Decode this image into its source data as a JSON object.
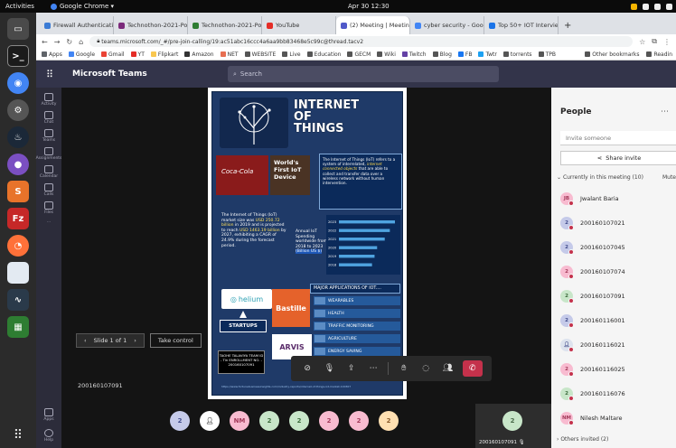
{
  "os": {
    "activities": "Activities",
    "app_name": "Google Chrome ▾",
    "clock": "Apr 30 12:30"
  },
  "browser": {
    "tabs": [
      {
        "label": "Firewall Authenticatio",
        "color": "#3a7bd5"
      },
      {
        "label": "Technothon-2021-Postr",
        "color": "#7b2a7b"
      },
      {
        "label": "Technothon-2021-Postr",
        "color": "#2e7d32"
      },
      {
        "label": "YouTube",
        "color": "#e52d27"
      },
      {
        "label": "(2) Meeting | Meeting",
        "color": "#5059c9"
      },
      {
        "label": "cyber security - Google",
        "color": "#4285f4"
      },
      {
        "label": "Top 50+ IOT Interview",
        "color": "#1a73e8"
      }
    ],
    "url": "teams.microsoft.com/_#/pre-join-calling/19:ac51abc16ccc4a6aa9bb83468e5c99c@thread.tacv2",
    "bookmarks": [
      {
        "label": "Apps",
        "color": "#5f6368"
      },
      {
        "label": "Google",
        "color": "#4285f4"
      },
      {
        "label": "Gmail",
        "color": "#ea4335"
      },
      {
        "label": "YT",
        "color": "#e52d27"
      },
      {
        "label": "Flipkart",
        "color": "#f9c74f"
      },
      {
        "label": "Amazon",
        "color": "#333333"
      },
      {
        "label": "NET",
        "color": "#e76f51"
      },
      {
        "label": "WEBSITE",
        "color": "#555555"
      },
      {
        "label": "Live",
        "color": "#555555"
      },
      {
        "label": "Education",
        "color": "#555555"
      },
      {
        "label": "GECM",
        "color": "#555555"
      },
      {
        "label": "Wiki",
        "color": "#555555"
      },
      {
        "label": "Twitch",
        "color": "#6441a5"
      },
      {
        "label": "Blog",
        "color": "#555555"
      },
      {
        "label": "FB",
        "color": "#1877f2"
      },
      {
        "label": "Twtr",
        "color": "#1da1f2"
      },
      {
        "label": "torrents",
        "color": "#555555"
      },
      {
        "label": "TPB",
        "color": "#555555"
      }
    ],
    "other_bookmarks": "Other bookmarks",
    "reading_list": "Readin"
  },
  "teams": {
    "app_title": "Microsoft Teams",
    "search_placeholder": "Search",
    "rail": [
      "Activity",
      "Chat",
      "Teams",
      "Assignments",
      "Calendar",
      "Calls",
      "Files",
      "..."
    ],
    "rail_bottom": [
      "Apps",
      "Help"
    ]
  },
  "poster": {
    "title_lines": [
      "INTERNET",
      "OF",
      "THINGS"
    ],
    "coke_text": "Coca-Cola",
    "world_first": "World's First IoT Device",
    "desc_pre": "The Internet of Things (IoT) refers to a system of interrelated,",
    "desc_hl": "internet connected objects",
    "desc_post": "that are able to collect and transfer data over a wireless network without human intervention.",
    "market_pre": "The Internet of Things (IoT) market size was",
    "market_hl1": "USD 250.72 billion",
    "market_mid": "in 2019 and is projected to reach",
    "market_hl2": "USD 1463.19 billion",
    "market_post": "by 2027, exhibiting a CAGR of 24.9% during the forecast period.",
    "spend_label": "Annual IoT Spending worldwide from 2018 to 2023",
    "spend_unit": "(Billion US $)",
    "spend_years": [
      "2023",
      "2022",
      "2021",
      "2020",
      "2019",
      "2018"
    ],
    "spend_values": [
      1100,
      1000,
      900,
      750,
      700,
      650
    ],
    "apps_title": "MAJOR APPLICATIONS OF IOT....",
    "apps": [
      "WEARABLES",
      "HEALTH",
      "TRAFFIC MONITORING",
      "AGRICULTURE",
      "ENERGY SAVING"
    ],
    "helium": "helium",
    "bastille": "Bastille",
    "startups": "STARTUPS",
    "arvis": "ARVIS",
    "team_info": "TAOHE TALAVIYA TEAM ID - Tin ENROLLMENT NO. - 200160107091",
    "footer": "https://www.fortunebusinessinsights.com/industry-reports/internet-of-things-iot-market-100307"
  },
  "meeting": {
    "slide_counter": "Slide 1 of 1",
    "take_control": "Take control",
    "presenter": "200160107091",
    "avatars": [
      {
        "initials": "2",
        "bg": "#c5cae9"
      },
      {
        "initials": "",
        "bg": "#ffffff"
      },
      {
        "initials": "NM",
        "bg": "#f8bbd0"
      },
      {
        "initials": "2",
        "bg": "#c8e6c9"
      },
      {
        "initials": "2",
        "bg": "#c8e6c9"
      },
      {
        "initials": "2",
        "bg": "#f8bbd0"
      },
      {
        "initials": "2",
        "bg": "#f8bbd0"
      },
      {
        "initials": "2",
        "bg": "#ffe0b2"
      }
    ],
    "self_tile_initial": "2",
    "self_tile_name": "200160107091"
  },
  "people": {
    "title": "People",
    "invite_placeholder": "Invite someone",
    "share_invite": "Share invite",
    "current_section": "Currently in this meeting (10)",
    "mute_all": "Mute",
    "participants": [
      {
        "initials": "JB",
        "name": "Jwalant Baria",
        "bg": "#f8bbd0",
        "fg": "#a33a5a"
      },
      {
        "initials": "2",
        "name": "200160107021",
        "bg": "#c5cae9",
        "fg": "#3f4a8a"
      },
      {
        "initials": "2",
        "name": "200160107045",
        "bg": "#c5cae9",
        "fg": "#3f4a8a"
      },
      {
        "initials": "2",
        "name": "200160107074",
        "bg": "#f8bbd0",
        "fg": "#a33a5a"
      },
      {
        "initials": "2",
        "name": "200160107091",
        "bg": "#c8e6c9",
        "fg": "#3a6a3a"
      },
      {
        "initials": "2",
        "name": "200160116001",
        "bg": "#c5cae9",
        "fg": "#3f4a8a"
      },
      {
        "initials": "",
        "name": "200160116021",
        "bg": "#dde3ee",
        "fg": "#3f4a8a"
      },
      {
        "initials": "2",
        "name": "200160116025",
        "bg": "#f8bbd0",
        "fg": "#a33a5a"
      },
      {
        "initials": "2",
        "name": "200160116076",
        "bg": "#c8e6c9",
        "fg": "#3a6a3a"
      },
      {
        "initials": "NM",
        "name": "Nilesh Maltare",
        "bg": "#f8bbd0",
        "fg": "#a33a5a"
      }
    ],
    "others_section": "Others invited (2)"
  }
}
